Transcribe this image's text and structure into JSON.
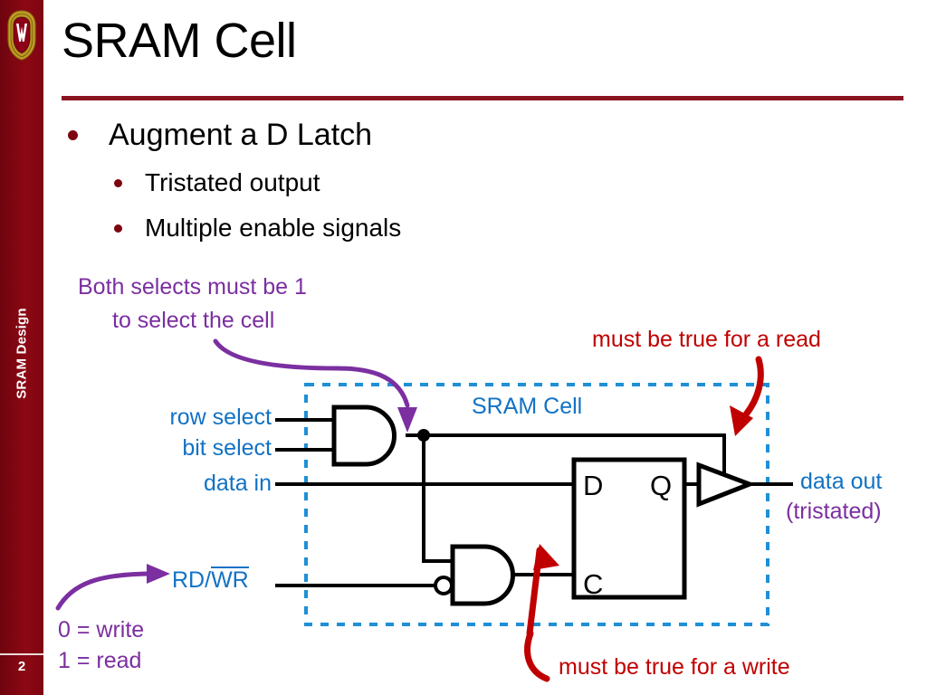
{
  "slide": {
    "title": "SRAM Cell",
    "page_number": "2",
    "sidebar_label": "SRAM Design",
    "logo_name": "uw-crest-logo"
  },
  "colors": {
    "brand_maroon": "#7d0510",
    "title_rule": "#8c1420",
    "annotation_purple": "#7b2fa0",
    "signal_blue": "#1272c4",
    "callout_red": "#c00000",
    "wire_black": "#000000",
    "cell_boundary_blue": "#1f8fd6"
  },
  "bullets": {
    "level1": "Augment a D Latch",
    "level2": [
      "Tristated output",
      "Multiple enable signals"
    ]
  },
  "annotations": {
    "both_selects_line1": "Both selects must be 1",
    "both_selects_line2": "to select the cell",
    "must_be_true_read": "must be true for a read",
    "must_be_true_write": "must be true for a write",
    "rd_wr_zero": "0 = write",
    "rd_wr_one": "1 = read",
    "tristated": "(tristated)"
  },
  "circuit": {
    "cell_label": "SRAM Cell",
    "inputs": [
      "row select",
      "bit select",
      "data in"
    ],
    "control_input_prefix": "RD/",
    "control_input_overline": "WR",
    "output": "data out",
    "latch_pins": {
      "d": "D",
      "q": "Q",
      "c": "C"
    },
    "gates": [
      "and-gate-select",
      "and-gate-write-enable",
      "tristate-buffer"
    ]
  }
}
